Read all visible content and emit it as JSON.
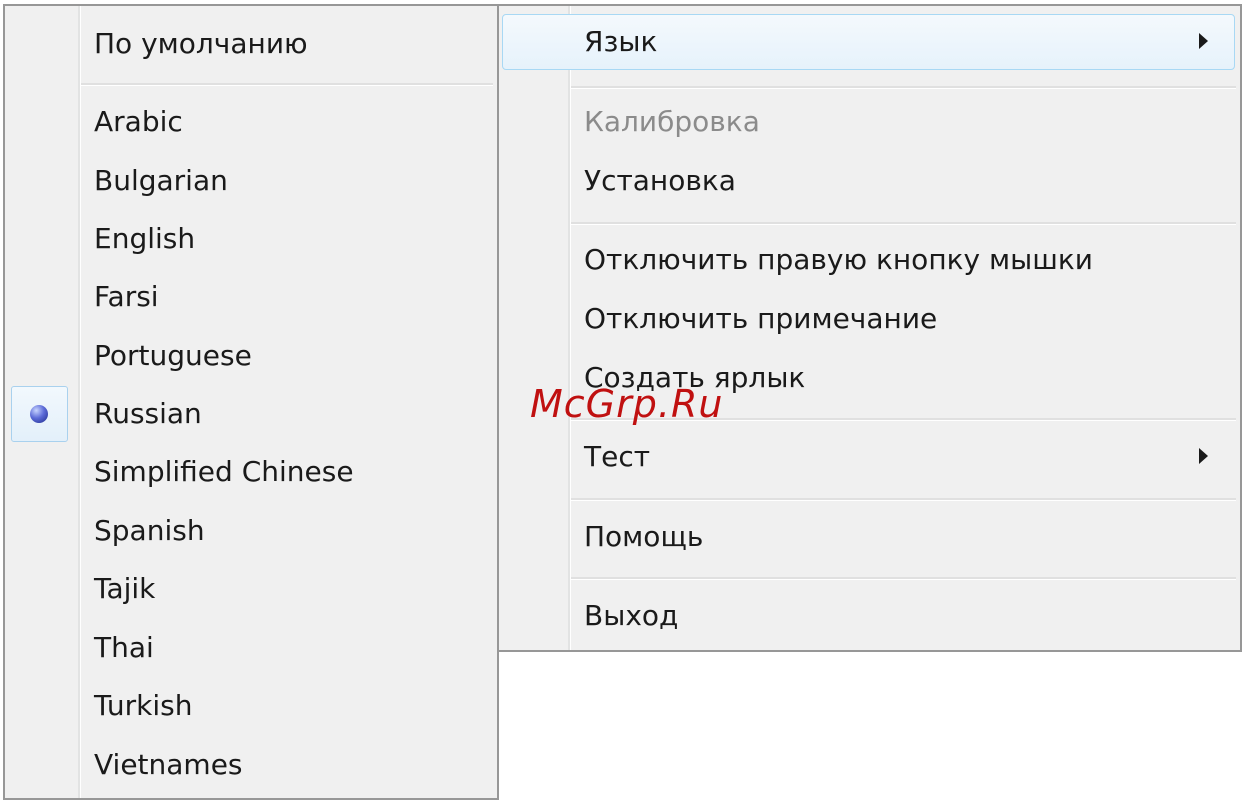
{
  "main_menu": {
    "items": [
      {
        "label": "Язык",
        "submenu": true,
        "disabled": false
      },
      {
        "label": "Калибровка",
        "submenu": false,
        "disabled": true
      },
      {
        "label": "Установка",
        "submenu": false,
        "disabled": false
      },
      {
        "label": "Отключить правую кнопку мышки",
        "submenu": false,
        "disabled": false
      },
      {
        "label": "Отключить примечание",
        "submenu": false,
        "disabled": false
      },
      {
        "label": "Создать ярлык",
        "submenu": false,
        "disabled": false
      },
      {
        "label": "Тест",
        "submenu": true,
        "disabled": false
      },
      {
        "label": "Помощь",
        "submenu": false,
        "disabled": false
      },
      {
        "label": "Выход",
        "submenu": false,
        "disabled": false
      }
    ]
  },
  "language_menu": {
    "default_label": "По умолчанию",
    "languages": [
      "Arabic",
      "Bulgarian",
      "English",
      "Farsi",
      "Portuguese",
      "Russian",
      "Simplified Chinese",
      "Spanish",
      "Tajik",
      "Thai",
      "Turkish",
      "Vietnames"
    ],
    "selected": "Russian"
  },
  "watermark": "McGrp.Ru",
  "icons": {
    "submenu_arrow": "chevron-right-icon",
    "radio": "radio-selected-icon"
  },
  "colors": {
    "menu_bg": "#f0f0f0",
    "menu_border": "#979797",
    "disabled_text": "#8b8b8b",
    "hover_border": "#a8d8f4",
    "watermark": "#c01010"
  }
}
